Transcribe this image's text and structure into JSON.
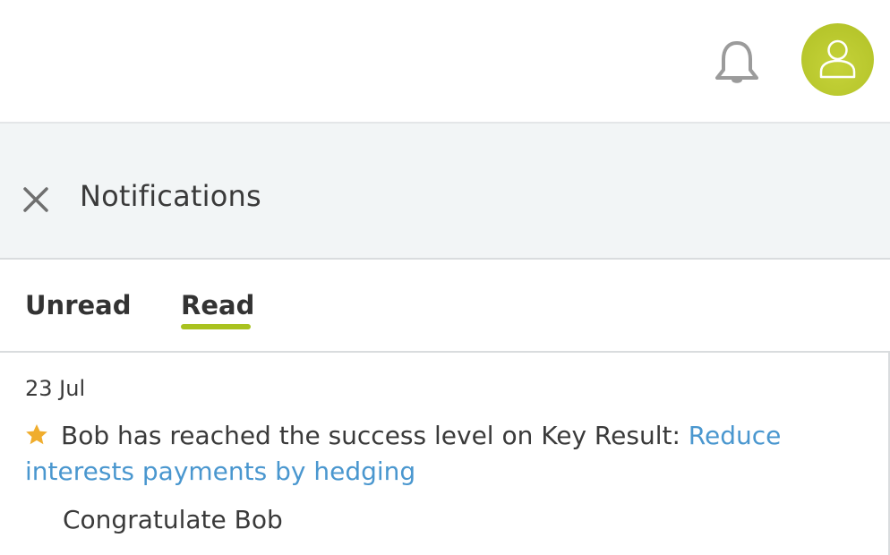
{
  "header": {
    "bell_icon": "bell-icon",
    "avatar_icon": "user-icon",
    "avatar_color": "#b7c82a"
  },
  "panel": {
    "title": "Notifications",
    "close_icon": "close-icon"
  },
  "tabs": {
    "unread_label": "Unread",
    "read_label": "Read",
    "active": "Read",
    "accent_color": "#a9c21f"
  },
  "notifications": [
    {
      "date": "23 Jul",
      "icon": "star-icon",
      "text": "Bob has reached the success level on Key Result: ",
      "link_text": "Reduce interests payments by hedging",
      "link_color": "#4a97cf",
      "action_label": "Congratulate Bob"
    }
  ]
}
